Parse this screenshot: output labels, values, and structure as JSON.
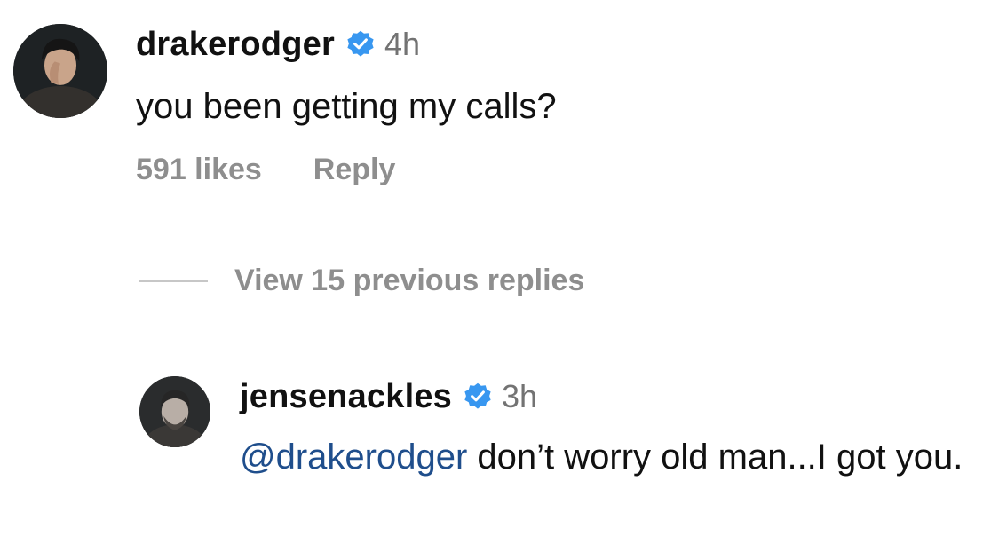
{
  "comment": {
    "username": "drakerodger",
    "timestamp": "4h",
    "text": "you been getting my calls?",
    "likes_label": "591 likes",
    "reply_label": "Reply"
  },
  "thread": {
    "view_replies_label": "View 15 previous replies"
  },
  "reply": {
    "username": "jensenackles",
    "timestamp": "3h",
    "mention": "@drakerodger",
    "text": " don’t worry old man...I got you."
  },
  "colors": {
    "verified_badge": "#3897f0",
    "mention": "#1f4e8c",
    "muted_text": "#8e8e8e"
  }
}
